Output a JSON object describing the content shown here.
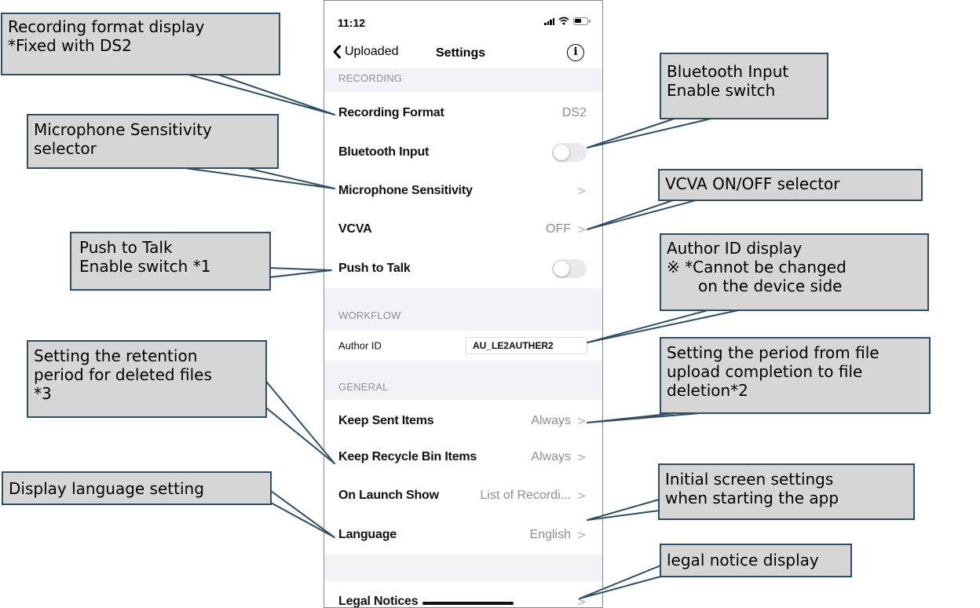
{
  "status_bar": {
    "time": "11:12"
  },
  "nav": {
    "back_label": "Uploaded",
    "title": "Settings"
  },
  "sections": {
    "recording": "RECORDING",
    "workflow": "WORKFLOW",
    "general": "GENERAL"
  },
  "rows": {
    "recording_format": {
      "label": "Recording Format",
      "value": "DS2"
    },
    "bluetooth_input": {
      "label": "Bluetooth Input",
      "on": false
    },
    "mic_sensitivity": {
      "label": "Microphone Sensitivity"
    },
    "vcva": {
      "label": "VCVA",
      "value": "OFF"
    },
    "push_to_talk": {
      "label": "Push to Talk",
      "on": false
    },
    "author_id": {
      "label": "Author ID",
      "value": "AU_LE2AUTHER2"
    },
    "keep_sent": {
      "label": "Keep Sent Items",
      "value": "Always"
    },
    "keep_recycle": {
      "label": "Keep Recycle Bin Items",
      "value": "Always"
    },
    "on_launch": {
      "label": "On Launch Show",
      "value": "List of Recordi..."
    },
    "language": {
      "label": "Language",
      "value": "English"
    },
    "legal": {
      "label": "Legal Notices"
    }
  },
  "callouts": {
    "recording_format": [
      "Recording format display",
      "*Fixed with DS2"
    ],
    "mic_sensitivity": [
      "Microphone Sensitivity",
      "selector"
    ],
    "push_to_talk": [
      "Push to Talk",
      "Enable switch *1"
    ],
    "retention": [
      "Setting the retention",
      "period for deleted files",
      "*3"
    ],
    "language": [
      "Display language setting"
    ],
    "bluetooth": [
      "Bluetooth Input",
      "Enable switch"
    ],
    "vcva": [
      "VCVA ON/OFF selector"
    ],
    "author_id": [
      "Author ID display",
      "※  *Cannot be changed",
      "on the device side"
    ],
    "upload_period": [
      "Setting the period from file",
      "upload completion to file",
      "deletion*2"
    ],
    "initial_screen": [
      "Initial screen settings",
      "when starting the app"
    ],
    "legal": [
      "legal notice display"
    ]
  },
  "colors": {
    "callout_fill": "#d6d6d6",
    "callout_border": "#2f4d63",
    "section_bg": "#f2f2f7",
    "secondary_text": "#8e8e93"
  },
  "icons": [
    "signal-icon",
    "wifi-icon",
    "battery-icon",
    "back-chevron-icon",
    "info-icon",
    "chevron-right-icon"
  ]
}
